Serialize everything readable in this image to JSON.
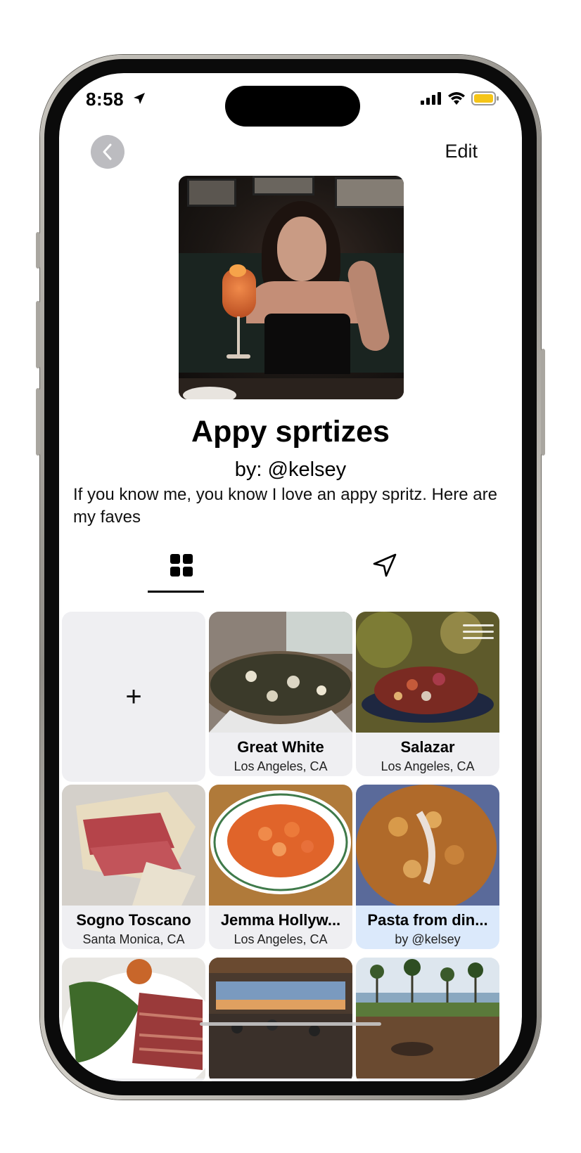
{
  "status": {
    "time": "8:58",
    "battery_color": "#F5C518"
  },
  "nav": {
    "back_icon": "chevron-left-icon",
    "edit_label": "Edit"
  },
  "list": {
    "title": "Appy sprtizes",
    "byline": "by: @kelsey",
    "description": "If you know me, you know I love an appy spritz. Here are my faves"
  },
  "tabs": [
    {
      "icon": "grid-icon",
      "selected": true
    },
    {
      "icon": "location-arrow-icon",
      "selected": false
    }
  ],
  "add_card": {
    "icon": "plus-icon",
    "label": "+"
  },
  "places": [
    {
      "name": "Great White",
      "location": "Los Angeles, CA",
      "highlighted": false
    },
    {
      "name": "Salazar",
      "location": "Los Angeles, CA",
      "highlighted": false
    },
    {
      "name": "Sogno Toscano",
      "location": "Santa Monica, CA",
      "highlighted": false
    },
    {
      "name": "Jemma Hollyw...",
      "location": "Los Angeles, CA",
      "highlighted": false
    },
    {
      "name": "Pasta from din...",
      "location": "by @kelsey",
      "highlighted": true
    },
    {
      "name": "",
      "location": "",
      "highlighted": false
    },
    {
      "name": "",
      "location": "",
      "highlighted": false
    },
    {
      "name": "",
      "location": "",
      "highlighted": false
    }
  ],
  "colors": {
    "card_bg": "#EFEFF2",
    "highlight_bg": "#DBE9FB",
    "back_button_bg": "#BCBCC0"
  }
}
